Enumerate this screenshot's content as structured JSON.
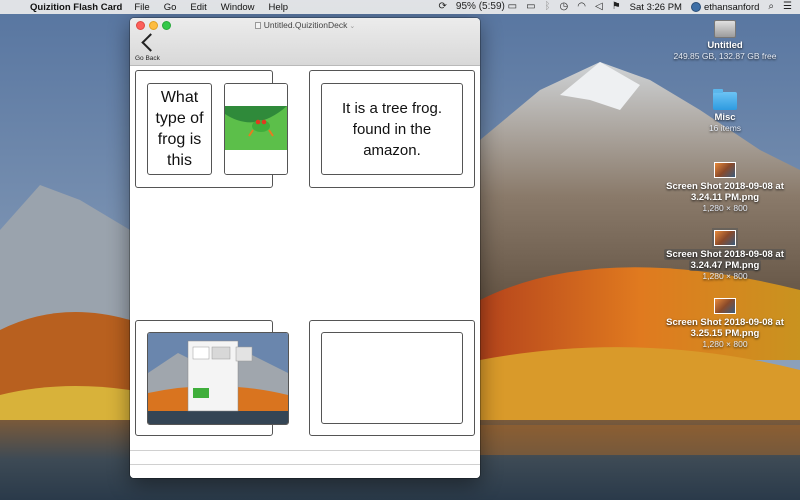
{
  "menubar": {
    "app_name": "Quizition Flash Card",
    "menus": [
      "File",
      "Go",
      "Edit",
      "Window",
      "Help"
    ],
    "battery": "95% (5:59)",
    "datetime": "Sat 3:26 PM",
    "username": "ethansanford",
    "status_icons": [
      "sync-icon",
      "battery-icon",
      "airplay-icon",
      "bluetooth-icon",
      "time-machine-icon",
      "wifi-icon",
      "volume-icon",
      "flag-icon",
      "user-icon",
      "search-icon",
      "menu-icon"
    ]
  },
  "window": {
    "document_title": "Untitled.QuizitionDeck",
    "back_label": "Go Back"
  },
  "cards": {
    "question_text": "What type of frog is this",
    "answer_text": "It is a tree frog. found in the amazon."
  },
  "desktop": {
    "items": [
      {
        "name": "Untitled",
        "sub": "249.85 GB, 132.87 GB free",
        "icon": "drive-icon"
      },
      {
        "name": "Misc",
        "sub": "16 items",
        "icon": "folder-icon"
      },
      {
        "name_line1": "Screen Shot 2018-09-08 at",
        "name_line2": "3.24.11 PM.png",
        "sub": "1,280 × 800",
        "icon": "screenshot-icon"
      },
      {
        "name_line1": "Screen Shot 2018-09-08 at",
        "name_line2": "3.24.47 PM.png",
        "sub": "1,280 × 800",
        "icon": "screenshot-icon"
      },
      {
        "name_line1": "Screen Shot 2018-09-08 at",
        "name_line2": "3.25.15 PM.png",
        "sub": "1,280 × 800",
        "icon": "screenshot-icon"
      }
    ]
  }
}
